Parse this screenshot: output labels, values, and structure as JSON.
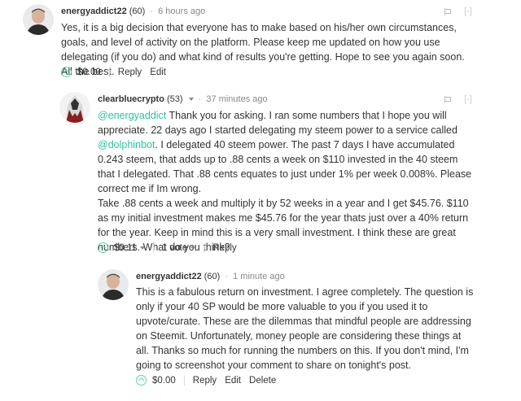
{
  "comments": [
    {
      "author": "energyaddict22",
      "rep": "(60)",
      "time": "6 hours ago",
      "collapse": "[-]",
      "body": "Yes, it is a big decision that everyone has to make based on his/her own circumstances, goals, and level of activity on the platform. Please keep me updated on how you use delegating (if you do) and what kind of results you're getting. Hope to see you again soon. All the best.",
      "payout": "$0.00",
      "actions": [
        "Reply",
        "Edit"
      ]
    },
    {
      "author": "clearbluecrypto",
      "rep": "(53)",
      "time": "37 minutes ago",
      "collapse": "[-]",
      "mention1": "@energyaddict",
      "text1": " Thank you for asking. I ran some numbers that I hope you will appreciate. 22 days ago I started delegating my steem power to a service called ",
      "mention2": "@dolphinbot",
      "text2": ". I delegated 40 steem power. The past 7 days I have accumulated 0.243 steem, that adds up to .88 cents a week on $110 invested in the 40 steem that I delegated. That .88 cents equates to just under 1% per week 0.008%. Please correct me if Im wrong.",
      "text3": "Take .88 cents a week and multiply it by 52 weeks in a year and I get $45.76. $110 as my initial investment makes me $45.76 for the year thats just over a 40% return for the year. Keep in mind this is a very small investment. I think these are great numbers. What do you think?",
      "payout": "$0.11",
      "votes": "1 vote",
      "actions": [
        "Reply"
      ]
    },
    {
      "author": "energyaddict22",
      "rep": "(60)",
      "time": "1 minute ago",
      "collapse": "[-]",
      "body": "This is a fabulous return on investment. I agree completely. The question is only if your 40 SP would be more valuable to you if you used it to upvote/curate. These are the dilemmas that mindful people are addressing on Steemit. Unfortunately, money people are considering these things at all. Thanks so much for running the numbers on this. If you don't mind, I'm going to screenshot your comment to share on tonight's post.",
      "payout": "$0.00",
      "actions": [
        "Reply",
        "Edit",
        "Delete"
      ]
    }
  ]
}
